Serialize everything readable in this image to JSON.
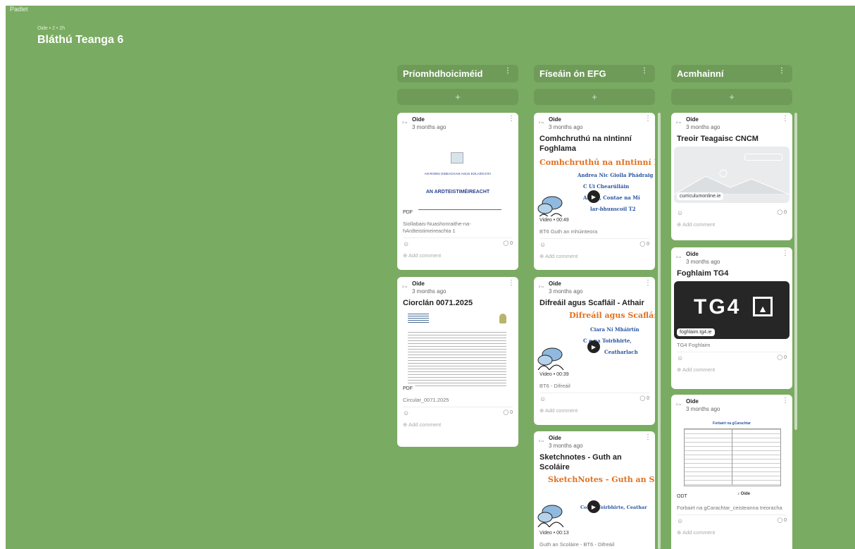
{
  "app": {
    "brand": "Padlet",
    "meta": "Oide • 2 • 2h",
    "title": "Bláthú Teanga 6"
  },
  "columns": [
    {
      "title": "Príomhdhoiciméid",
      "dots": "⋮",
      "add": "+"
    },
    {
      "title": "Físeáin ón EFG",
      "dots": "⋮",
      "add": "+"
    },
    {
      "title": "Acmhainní",
      "dots": "⋮",
      "add": "+"
    }
  ],
  "common": {
    "author": "Oide",
    "time": "3 months ago",
    "add_comment": "Add comment",
    "comments": "0",
    "kebab": "⋮",
    "avatar": "Z ▭"
  },
  "cards": {
    "c1a": {
      "pdf_tag": "PDF",
      "doc_line1": "AN ROINN OIDEACHAIS AGUS EOLAÍOCHTA",
      "doc_line2": "AN ARDTEISTIMÉIREACHT",
      "caption": "Siollabais-Nuashonraithe-na-hArdteistimeireachta 1"
    },
    "c1b": {
      "title": "Ciorclán 0071.2025",
      "pdf_tag": "PDF",
      "caption": "Circular_0071.2025"
    },
    "c2a": {
      "title": "Comhchruthú na nIntinní Foghlama",
      "v1": "Comhchruthú na nIntinní F",
      "v2": "Andrea Nic Giolla Phádraig",
      "v3": "C    Ui Chearúlláin",
      "v4": "An    air, Contae na Mí",
      "v5": "lar-bhunscoil T2",
      "tag": "Video • 00:49",
      "caption": "BT6 Guth an mhúinteora"
    },
    "c2b": {
      "title": "Difreáil agus Scafláil - Athair",
      "v1": "Difreáil agus Scaflá:",
      "v2": "Ciara Ní Mháirtín",
      "v3": "C    e na Toirbhirte,",
      "v4": "Ceatharlach",
      "tag": "Video • 00:39",
      "caption": "BT6 - Difreáil"
    },
    "c2c": {
      "title": "Sketchnotes - Guth an Scoláire",
      "v1": "SketchNotes - Guth an Sc",
      "v2": "Coláis    Toirbhirte, Ceathar",
      "tag": "Video • 00:13",
      "caption": "Guth an Scoláire - BT6 - Difreáil"
    },
    "c3a": {
      "title": "Treoir Teagaisc CNCM",
      "tag": "curriculumonline.ie"
    },
    "c3b": {
      "title": "Foghlaim TG4",
      "logo": "TG4",
      "tag": "foghlaim.tg4.ie",
      "caption": "TG4 Foghlaim"
    },
    "c3c": {
      "doc_title": "Forbairt na gCarachtar",
      "tag": "ODT",
      "oide": "Oide",
      "caption": "Forbairt na gCarachtar_ceisteanna treoracha"
    }
  }
}
